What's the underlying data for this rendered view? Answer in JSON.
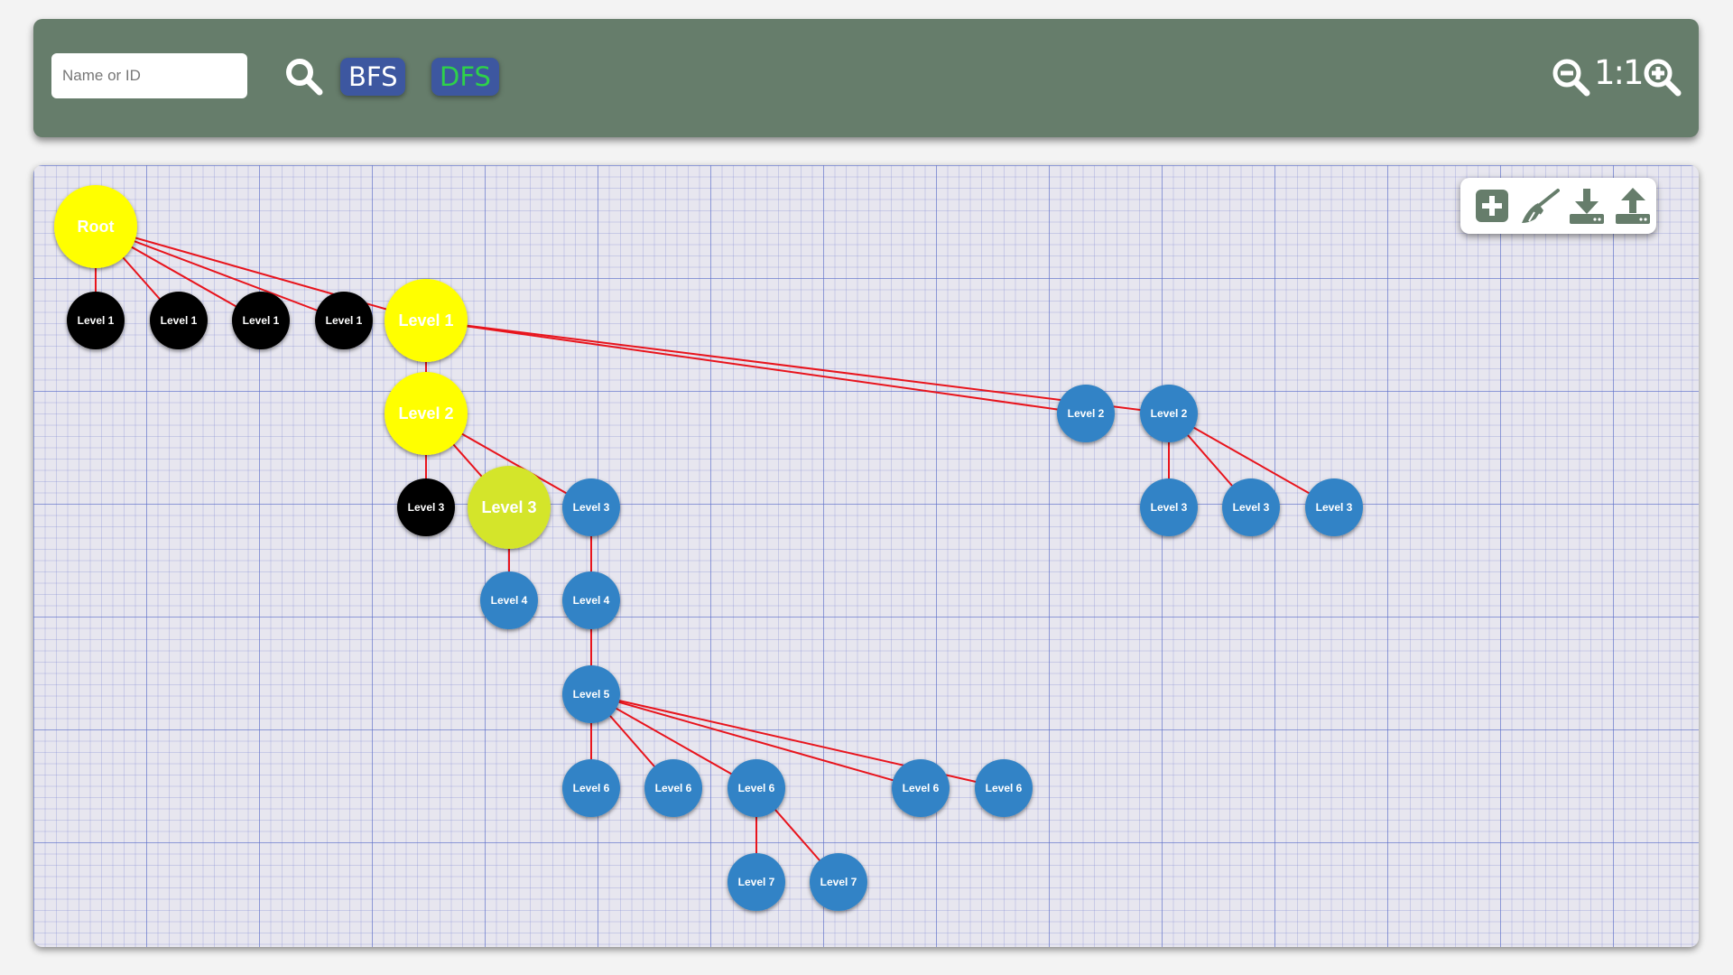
{
  "toolbar": {
    "search_placeholder": "Name or ID",
    "bfs_label": "BFS",
    "dfs_label": "DFS",
    "zoom_label": "1:1"
  },
  "colors": {
    "toolbar_bg": "#667d6b",
    "bfs_text": "#ffffff",
    "dfs_text": "#2ed14a",
    "button_bg": "#3d57a0",
    "edge": "#e8141c",
    "node_yellow": "#ffff00",
    "node_lime": "#d4e52a",
    "node_black": "#000000",
    "node_blue": "#3283c6",
    "tool_icon": "#667d6b"
  },
  "canvas_tools": [
    {
      "name": "add-node-button",
      "icon": "plus-square-icon"
    },
    {
      "name": "clear-button",
      "icon": "broom-icon"
    },
    {
      "name": "download-button",
      "icon": "download-icon"
    },
    {
      "name": "upload-button",
      "icon": "upload-icon"
    }
  ],
  "graph": {
    "nodes": [
      {
        "id": "root",
        "label": "Root",
        "color": "yellow",
        "large": true
      },
      {
        "id": "l1a",
        "label": "Level 1",
        "color": "black"
      },
      {
        "id": "l1b",
        "label": "Level 1",
        "color": "black"
      },
      {
        "id": "l1c",
        "label": "Level 1",
        "color": "black"
      },
      {
        "id": "l1d",
        "label": "Level 1",
        "color": "black"
      },
      {
        "id": "l1e",
        "label": "Level 1",
        "color": "yellow",
        "large": true
      },
      {
        "id": "l2a",
        "label": "Level 2",
        "color": "yellow",
        "large": true
      },
      {
        "id": "l2b",
        "label": "Level 2",
        "color": "blue"
      },
      {
        "id": "l2c",
        "label": "Level 2",
        "color": "blue"
      },
      {
        "id": "l3a",
        "label": "Level 3",
        "color": "black"
      },
      {
        "id": "l3b",
        "label": "Level 3",
        "color": "lime",
        "large": true
      },
      {
        "id": "l3c",
        "label": "Level 3",
        "color": "blue"
      },
      {
        "id": "l3d",
        "label": "Level 3",
        "color": "blue"
      },
      {
        "id": "l3e",
        "label": "Level 3",
        "color": "blue"
      },
      {
        "id": "l3f",
        "label": "Level 3",
        "color": "blue"
      },
      {
        "id": "l4a",
        "label": "Level 4",
        "color": "blue"
      },
      {
        "id": "l4b",
        "label": "Level 4",
        "color": "blue"
      },
      {
        "id": "l5a",
        "label": "Level 5",
        "color": "blue"
      },
      {
        "id": "l6a",
        "label": "Level 6",
        "color": "blue"
      },
      {
        "id": "l6b",
        "label": "Level 6",
        "color": "blue"
      },
      {
        "id": "l6c",
        "label": "Level 6",
        "color": "blue"
      },
      {
        "id": "l6d",
        "label": "Level 6",
        "color": "blue"
      },
      {
        "id": "l6e",
        "label": "Level 6",
        "color": "blue"
      },
      {
        "id": "l7a",
        "label": "Level 7",
        "color": "blue"
      },
      {
        "id": "l7b",
        "label": "Level 7",
        "color": "blue"
      }
    ],
    "edges": [
      [
        "root",
        "l1a"
      ],
      [
        "root",
        "l1b"
      ],
      [
        "root",
        "l1c"
      ],
      [
        "root",
        "l1d"
      ],
      [
        "root",
        "l1e"
      ],
      [
        "l1e",
        "l2a"
      ],
      [
        "l1e",
        "l2b"
      ],
      [
        "l1e",
        "l2c"
      ],
      [
        "l2a",
        "l3a"
      ],
      [
        "l2a",
        "l3b"
      ],
      [
        "l2a",
        "l3c"
      ],
      [
        "l2c",
        "l3d"
      ],
      [
        "l2c",
        "l3e"
      ],
      [
        "l2c",
        "l3f"
      ],
      [
        "l3b",
        "l4a"
      ],
      [
        "l3c",
        "l4b"
      ],
      [
        "l4b",
        "l5a"
      ],
      [
        "l5a",
        "l6a"
      ],
      [
        "l5a",
        "l6b"
      ],
      [
        "l5a",
        "l6c"
      ],
      [
        "l5a",
        "l6d"
      ],
      [
        "l5a",
        "l6e"
      ],
      [
        "l6c",
        "l7a"
      ],
      [
        "l6c",
        "l7b"
      ]
    ]
  }
}
